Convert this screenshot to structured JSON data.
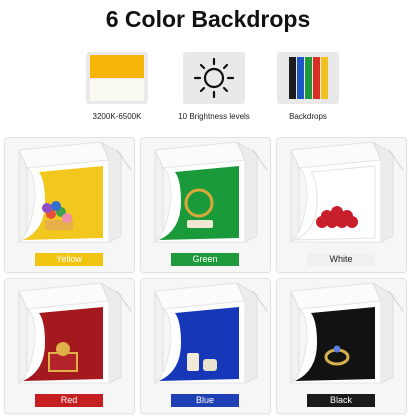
{
  "title": "6 Color Backdrops",
  "features": [
    {
      "caption": "3200K-6500K",
      "icon": "color-temperature-swatch-icon"
    },
    {
      "caption": "10 Brightness levels",
      "icon": "sun-icon"
    },
    {
      "caption": "Backdrops",
      "icon": "backdrop-sheets-icon"
    }
  ],
  "backdrop_sheet_colors": [
    "#1c1c1c",
    "#1f56c7",
    "#1f9a3b",
    "#d92f27",
    "#f0c020"
  ],
  "backdrops": [
    {
      "label": "Yellow",
      "color": "#f2c81f",
      "label_bg": "#f1c40f",
      "label_fg": "#ffffff",
      "product": "toys"
    },
    {
      "label": "Green",
      "color": "#1a9a3b",
      "label_bg": "#1e9a3c",
      "label_fg": "#ffffff",
      "product": "bracelet"
    },
    {
      "label": "White",
      "color": "#ffffff",
      "label_bg": "#f0f0f0",
      "label_fg": "#222222",
      "product": "cherries"
    },
    {
      "label": "Red",
      "color": "#a3191d",
      "label_bg": "#c51f22",
      "label_fg": "#ffffff",
      "product": "gift-box"
    },
    {
      "label": "Blue",
      "color": "#1638b8",
      "label_bg": "#1f3fb4",
      "label_fg": "#ffffff",
      "product": "cosmetics"
    },
    {
      "label": "Black",
      "color": "#121212",
      "label_bg": "#1a1a1a",
      "label_fg": "#ffffff",
      "product": "ring"
    }
  ]
}
